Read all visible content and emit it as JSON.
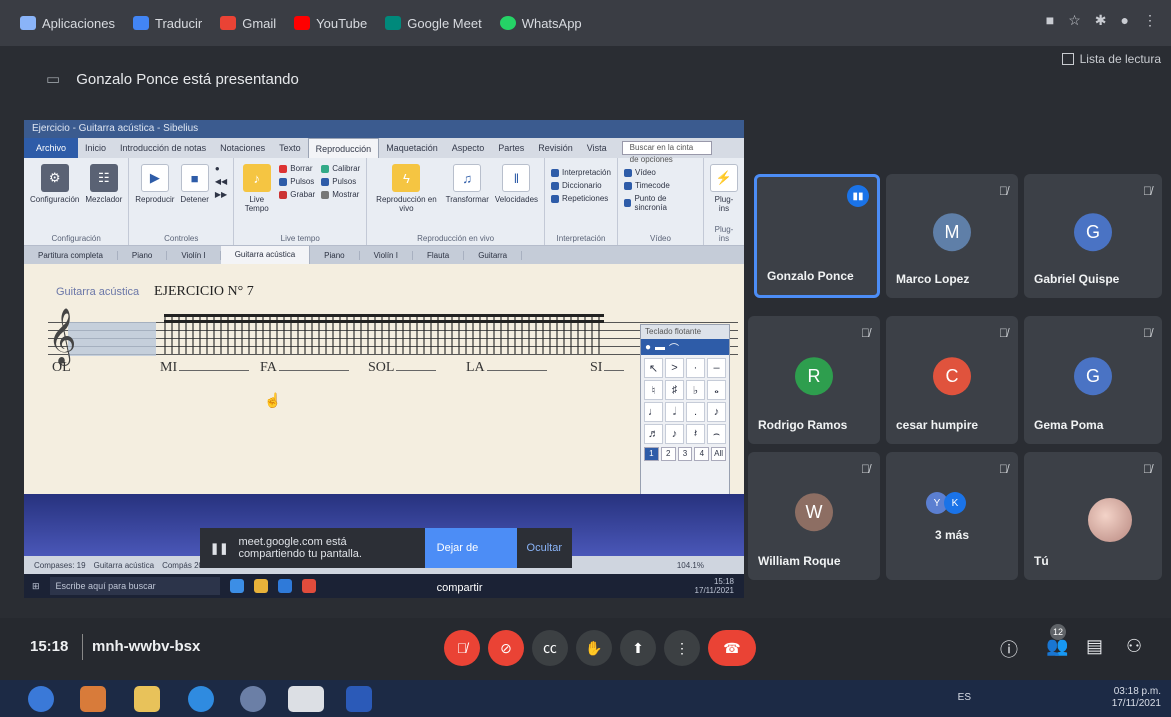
{
  "bookmarks": {
    "items": [
      {
        "label": "Aplicaciones",
        "icon": "apps-grid-icon",
        "color": "#8ab4f8"
      },
      {
        "label": "Traducir",
        "icon": "translate-icon",
        "color": "#4285f4"
      },
      {
        "label": "Gmail",
        "icon": "gmail-icon",
        "color": "#ea4335"
      },
      {
        "label": "YouTube",
        "icon": "youtube-icon",
        "color": "#ff0000"
      },
      {
        "label": "Google Meet",
        "icon": "google-meet-icon",
        "color": "#00897b"
      },
      {
        "label": "WhatsApp",
        "icon": "whatsapp-icon",
        "color": "#25d366"
      }
    ],
    "reading_list": "Lista de lectura"
  },
  "presenting": {
    "text": "Gonzalo Ponce está presentando"
  },
  "shared_screen": {
    "window_title": "Ejercicio - Guitarra acústica - Sibelius",
    "menu_tabs": [
      "Archivo",
      "Inicio",
      "Introducción de notas",
      "Notaciones",
      "Texto",
      "Reproducción",
      "Maquetación",
      "Aspecto",
      "Partes",
      "Revisión",
      "Vista"
    ],
    "active_tab": "Reproducción",
    "search_placeholder": "Buscar en la cinta de opciones",
    "ribbon": {
      "group1_label": "Configuración",
      "btn_config": "Configuración",
      "btn_mezclador": "Mezclador",
      "group2_label": "Controles",
      "btn_reproducir": "Reproducir",
      "btn_detener": "Detener",
      "group3_label": "Live tempo",
      "btn_live_tempo": "Live Tempo",
      "small_borrar": "Borrar",
      "small_pulsos": "Pulsos",
      "small_grabar": "Grabar",
      "small_calibrar": "Calibrar",
      "small_pulsos2": "Pulsos",
      "small_mostrar": "Mostrar",
      "group4_label": "Reproducción en vivo",
      "btn_repro_vivo": "Reproducción en vivo",
      "btn_transformar": "Transformar",
      "btn_velocidades": "Velocidades",
      "group5_label": "Interpretación",
      "small_interpretacion": "Interpretación",
      "small_diccionario": "Diccionario",
      "small_repeticiones": "Repeticiones",
      "group6_label": "Vídeo",
      "small_video": "Vídeo",
      "small_timecode": "Timecode",
      "small_punto": "Punto de sincronía",
      "group7_label": "Plug-ins",
      "btn_plugins": "Plug-ins"
    },
    "doc_tabs": [
      "Partitura completa",
      "Piano",
      "Violín I",
      "Guitarra acústica",
      "Piano",
      "Violín I",
      "Flauta",
      "Guitarra"
    ],
    "instrument_label": "Guitarra acústica",
    "exercise_title": "EJERCICIO N° 7",
    "syllables": [
      "OL",
      "MI",
      "FA",
      "SOL",
      "LA",
      "SI"
    ],
    "keypad": {
      "title": "Teclado flotante",
      "footer": [
        "1",
        "2",
        "3",
        "4",
        "All"
      ]
    },
    "status": [
      "Compases: 19",
      "Guitarra acústica",
      "Compás 20"
    ],
    "zoom": "104.1%",
    "win_search": "Escribe aquí para buscar",
    "win_time": "15:18",
    "win_date": "17/11/2021"
  },
  "share_banner": {
    "message": "meet.google.com está compartiendo tu pantalla.",
    "stop_label": "Dejar de compartir",
    "hide_label": "Ocultar"
  },
  "participants": [
    {
      "name": "Gonzalo Ponce",
      "initial": "",
      "color": "#3c4047"
    },
    {
      "name": "Marco Lopez",
      "initial": "M",
      "color": "#5f7fa8"
    },
    {
      "name": "Gabriel Quispe",
      "initial": "G",
      "color": "#4a73c4"
    },
    {
      "name": "Rodrigo Ramos",
      "initial": "R",
      "color": "#2e9e4e"
    },
    {
      "name": "cesar humpire",
      "initial": "C",
      "color": "#e0533d"
    },
    {
      "name": "Gema Poma",
      "initial": "G",
      "color": "#4a73c4"
    },
    {
      "name": "William Roque",
      "initial": "W",
      "color": "#8d6e63"
    },
    {
      "name": "3 más",
      "initial": "",
      "color": "#3c4047"
    },
    {
      "name": "Tú",
      "initial": "",
      "color": "#3c4047"
    }
  ],
  "more_avatars": [
    {
      "initial": "Y",
      "color": "#5b7fd1"
    },
    {
      "initial": "K",
      "color": "#1a73e8"
    }
  ],
  "controls": {
    "time": "15:18",
    "meeting_code": "mnh-wwbv-bsx",
    "participants_count": "12"
  },
  "os_taskbar": {
    "lang": "ES",
    "time": "03:18 p.m.",
    "date": "17/11/2021"
  }
}
